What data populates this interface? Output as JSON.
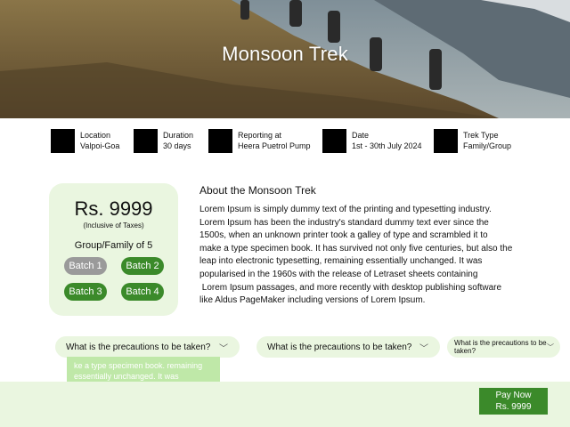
{
  "hero": {
    "title": "Monsoon Trek"
  },
  "info": [
    {
      "label": "Location",
      "value": "Valpoi-Goa"
    },
    {
      "label": "Duration",
      "value": "30 days"
    },
    {
      "label": "Reporting at",
      "value": "Heera Puetrol Pump"
    },
    {
      "label": "Date",
      "value": "1st - 30th July 2024"
    },
    {
      "label": "Trek Type",
      "value": "Family/Group"
    }
  ],
  "price_card": {
    "price": "Rs. 9999",
    "tax_note": "(Inclusive of Taxes)",
    "group": "Group/Family of 5",
    "batches": [
      "Batch 1",
      "Batch 2",
      "Batch 3",
      "Batch 4"
    ]
  },
  "about": {
    "title": "About the Monsoon Trek",
    "lines": [
      "Lorem Ipsum is simply dummy text of the printing and typesetting industry.",
      "Lorem Ipsum has been the industry's standard dummy text ever since the",
      "1500s, when an unknown printer took a galley of type and scrambled it to",
      "make a type specimen book. It has survived not only five centuries, but also the",
      "leap into electronic typesetting, remaining essentially unchanged. It was",
      "popularised in the 1960s with the release of Letraset sheets containing",
      " Lorem Ipsum passages, and more recently with desktop publishing software",
      "like Aldus PageMaker including versions of Lorem Ipsum."
    ]
  },
  "faq": [
    {
      "question": "What is the precautions to be taken?"
    },
    {
      "question": "What is the precautions to be taken?"
    },
    {
      "question": "What is the precautions to be taken?"
    }
  ],
  "faq_answer": {
    "line1": "ke a type specimen book. remaining",
    "line2": "essentially unchanged. It was"
  },
  "footer": {
    "pay_label": "Pay Now",
    "pay_amount": "Rs. 9999"
  },
  "colors": {
    "accent_green": "#3b8a2a",
    "light_green": "#eaf6e0",
    "batch_disabled": "#9a9a9a"
  }
}
